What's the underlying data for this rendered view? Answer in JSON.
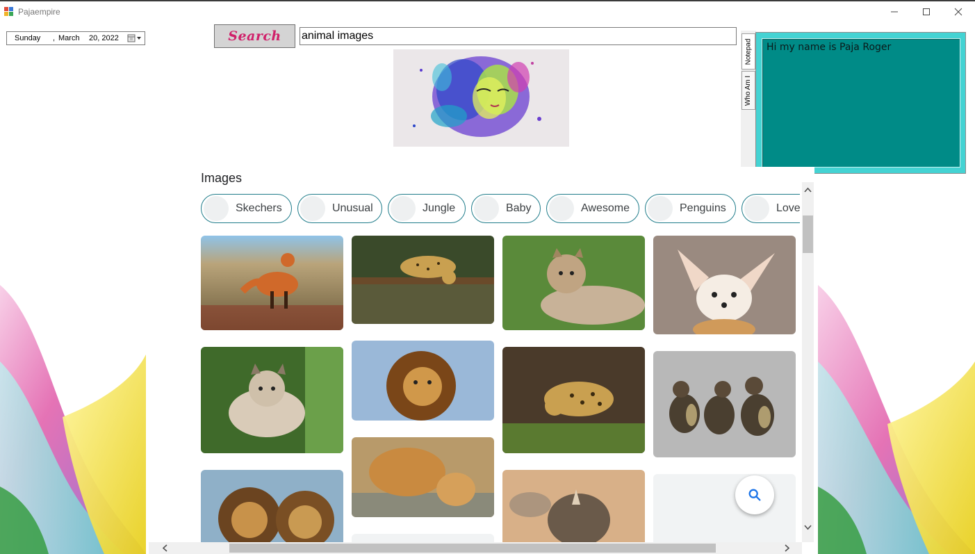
{
  "window": {
    "title": "Pajaempire"
  },
  "datepicker": {
    "day": "Sunday",
    "separator": ",",
    "month": "March",
    "date_year": "20, 2022"
  },
  "search": {
    "button_label": "Search",
    "query": "animal images"
  },
  "tabs": {
    "notepad": "Notepad",
    "who_am_i": "Who Am I"
  },
  "notepad": {
    "text": "Hi my name is Paja Roger"
  },
  "results": {
    "heading": "Images",
    "chips": [
      "Skechers",
      "Unusual",
      "Jungle",
      "Baby",
      "Awesome",
      "Penguins",
      "Love"
    ],
    "images": [
      "fox",
      "jaguar",
      "cougar",
      "fennec-fox",
      "lynx-kitten",
      "lion",
      "leopard",
      "ducklings",
      "lions",
      "lioness-and-cub",
      "rhino"
    ]
  },
  "colors": {
    "notepad_bg": "#008b87",
    "notepad_frame": "#44d3d3",
    "search_label": "#d0206a",
    "chip_border": "#1f7c8a",
    "fab_icon": "#1a73e8"
  },
  "icons": [
    "app-icon",
    "minimize-icon",
    "maximize-icon",
    "close-icon",
    "calendar-dropdown-icon",
    "search-icon",
    "scroll-up-icon",
    "scroll-down-icon",
    "scroll-left-icon",
    "scroll-right-icon"
  ]
}
